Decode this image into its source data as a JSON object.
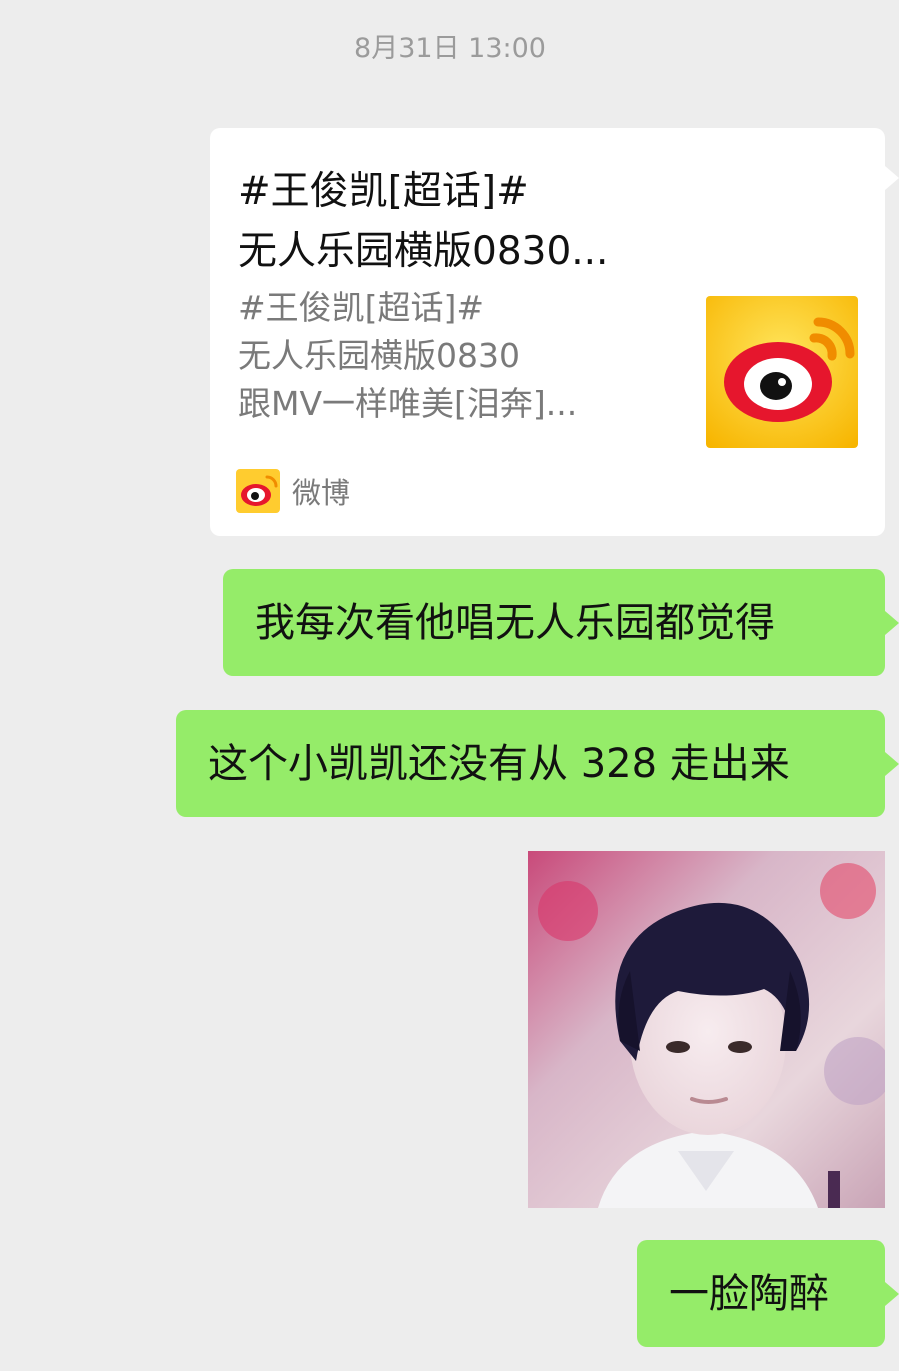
{
  "chat": {
    "timestamp": "8月31日 13:00",
    "share_card": {
      "title": "#王俊凯[超话]#\n无人乐园横版0830...",
      "description": "#王俊凯[超话]#\n无人乐园横版0830\n跟MV一样唯美[泪奔]...",
      "thumbnail_icon": "weibo-logo-icon",
      "source_icon": "weibo-logo-icon",
      "source_label": "微博"
    },
    "messages": [
      {
        "text": "我每次看他唱无人乐园都觉得"
      },
      {
        "text": "这个小凯凯还没有从 328 走出来"
      },
      {
        "type": "image",
        "image": "photo-of-boy-portrait"
      },
      {
        "text": "一脸陶醉"
      }
    ]
  },
  "colors": {
    "background": "#ededed",
    "sent_bubble": "#95ec69",
    "card_background": "#ffffff",
    "muted_text": "#7a7a7a"
  }
}
